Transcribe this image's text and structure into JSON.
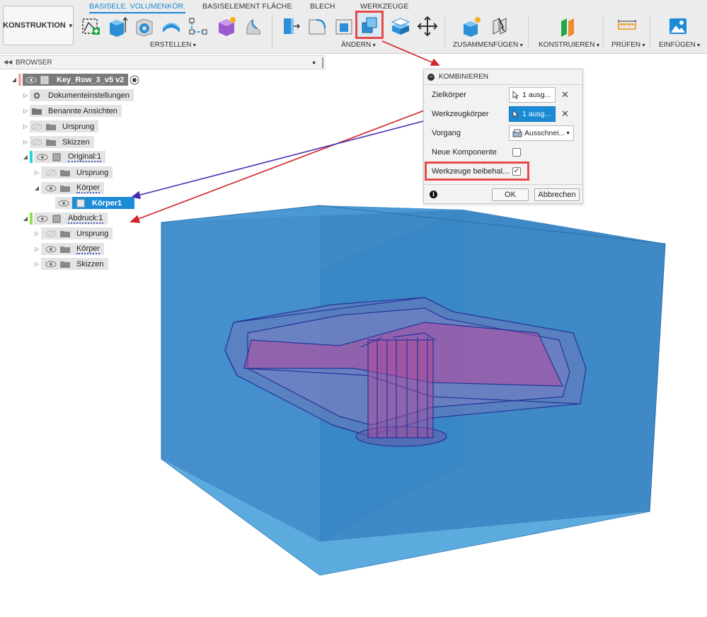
{
  "toolbar": {
    "workspace": "KONSTRUKTION",
    "tabs": [
      {
        "label": "BASISELE. VOLUMENKÖR.",
        "active": true
      },
      {
        "label": "BASISELEMENT FLÄCHE",
        "active": false
      },
      {
        "label": "BLECH",
        "active": false
      },
      {
        "label": "WERKZEUGE",
        "active": false
      }
    ],
    "groups": {
      "erstellen": "ERSTELLEN",
      "aendern": "ÄNDERN",
      "zusammenfuegen": "ZUSAMMENFÜGEN",
      "konstruieren": "KONSTRUIEREN",
      "pruefen": "PRÜFEN",
      "einfuegen": "EINFÜGEN"
    },
    "highlighted_tool": "combine-icon",
    "colors": {
      "accent": "#1a86d0",
      "highlight": "#e84a4a"
    }
  },
  "browser": {
    "title": "BROWSER",
    "root": "Key_Row_3_v5 v2",
    "items": [
      {
        "label": "Dokumenteinstellungen"
      },
      {
        "label": "Benannte Ansichten"
      },
      {
        "label": "Ursprung"
      },
      {
        "label": "Skizzen"
      },
      {
        "label": "Original:1"
      },
      {
        "label": "Ursprung"
      },
      {
        "label": "Körper"
      },
      {
        "label": "Körper1"
      },
      {
        "label": "Abdruck:1"
      },
      {
        "label": "Ursprung"
      },
      {
        "label": "Körper"
      },
      {
        "label": "Skizzen"
      }
    ]
  },
  "dialog": {
    "title": "KOMBINIEREN",
    "target_label": "Zielkörper",
    "target_value": "1 ausg...",
    "tool_label": "Werkzeugkörper",
    "tool_value": "1 ausg...",
    "operation_label": "Vorgang",
    "operation_value": "Ausschnei...",
    "new_component_label": "Neue Komponente",
    "new_component_checked": false,
    "keep_tools_label": "Werkzeuge beibehal...",
    "keep_tools_checked": true,
    "ok": "OK",
    "cancel": "Abbrechen",
    "clear_glyph": "✕",
    "check_glyph": "✓"
  }
}
